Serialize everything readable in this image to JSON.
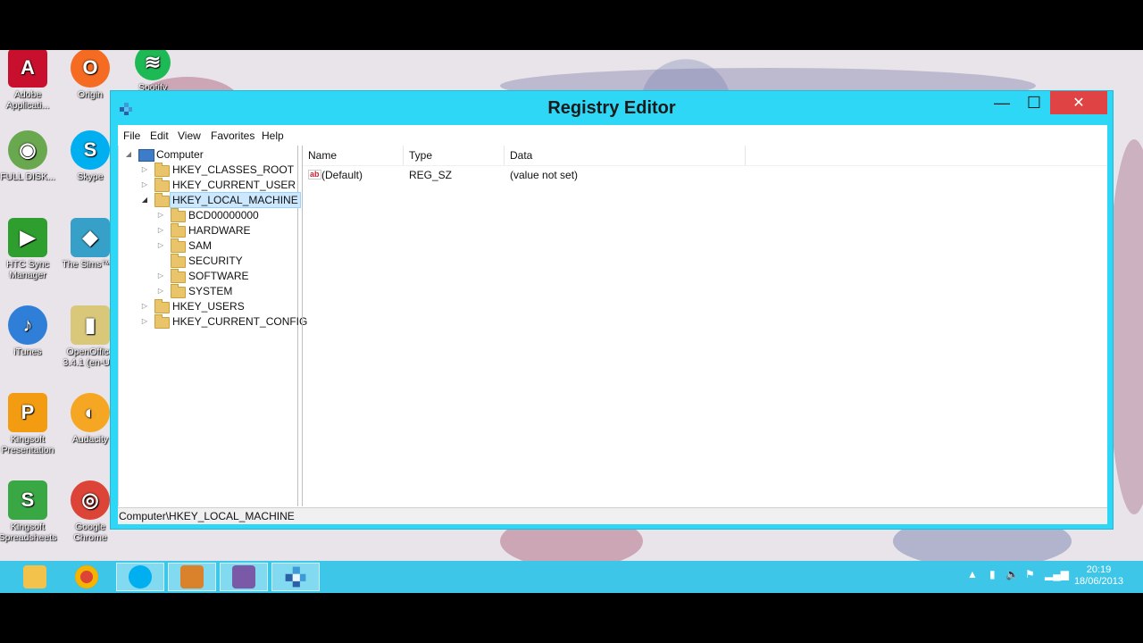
{
  "desktop": {
    "icons": [
      {
        "label": "Adobe Applicati...",
        "color": "#c8102e",
        "glyph": "A"
      },
      {
        "label": "Origin",
        "color": "#f46b21",
        "glyph": "O"
      },
      {
        "label": "Spotify",
        "color": "#1db954",
        "glyph": "≋"
      },
      {
        "label": "FULL DISK...",
        "color": "#6aa84f",
        "glyph": "◉"
      },
      {
        "label": "Skype",
        "color": "#00aff0",
        "glyph": "S"
      },
      {
        "label": "HTC Sync Manager",
        "color": "#2e9e2e",
        "glyph": "▶"
      },
      {
        "label": "The Sims™ 3",
        "color": "#37a0c8",
        "glyph": "◆"
      },
      {
        "label": "iTunes",
        "color": "#2f7fd9",
        "glyph": "♪"
      },
      {
        "label": "OpenOffice 3.4.1 (en-U...",
        "color": "#d9c77a",
        "glyph": "▮"
      },
      {
        "label": "Kingsoft Presentation",
        "color": "#f39c12",
        "glyph": "P"
      },
      {
        "label": "Audacity",
        "color": "#f5a623",
        "glyph": "◐"
      },
      {
        "label": "Kingsoft Spreadsheets",
        "color": "#3aa745",
        "glyph": "S"
      },
      {
        "label": "Google Chrome",
        "color": "#db4437",
        "glyph": "◎"
      }
    ]
  },
  "window": {
    "title": "Registry Editor",
    "controls": {
      "minimize": "—",
      "maximize": "☐",
      "close": "✕"
    },
    "menu": [
      "File",
      "Edit",
      "View",
      "Favorites",
      "Help"
    ],
    "tree": {
      "root": "Computer",
      "hives": [
        "HKEY_CLASSES_ROOT",
        "HKEY_CURRENT_USER",
        "HKEY_LOCAL_MACHINE",
        "HKEY_USERS",
        "HKEY_CURRENT_CONFIG"
      ],
      "hklm_children": [
        "BCD00000000",
        "HARDWARE",
        "SAM",
        "SECURITY",
        "SOFTWARE",
        "SYSTEM"
      ],
      "selected": "HKEY_LOCAL_MACHINE"
    },
    "list": {
      "headers": [
        "Name",
        "Type",
        "Data"
      ],
      "rows": [
        {
          "name": "(Default)",
          "type": "REG_SZ",
          "data": "(value not set)"
        }
      ]
    },
    "status": "Computer\\HKEY_LOCAL_MACHINE"
  },
  "taskbar": {
    "items": [
      "file-explorer",
      "chrome",
      "skype",
      "app-4",
      "app-5",
      "registry-editor"
    ],
    "clock": {
      "time": "20:19",
      "date": "18/06/2013"
    }
  }
}
